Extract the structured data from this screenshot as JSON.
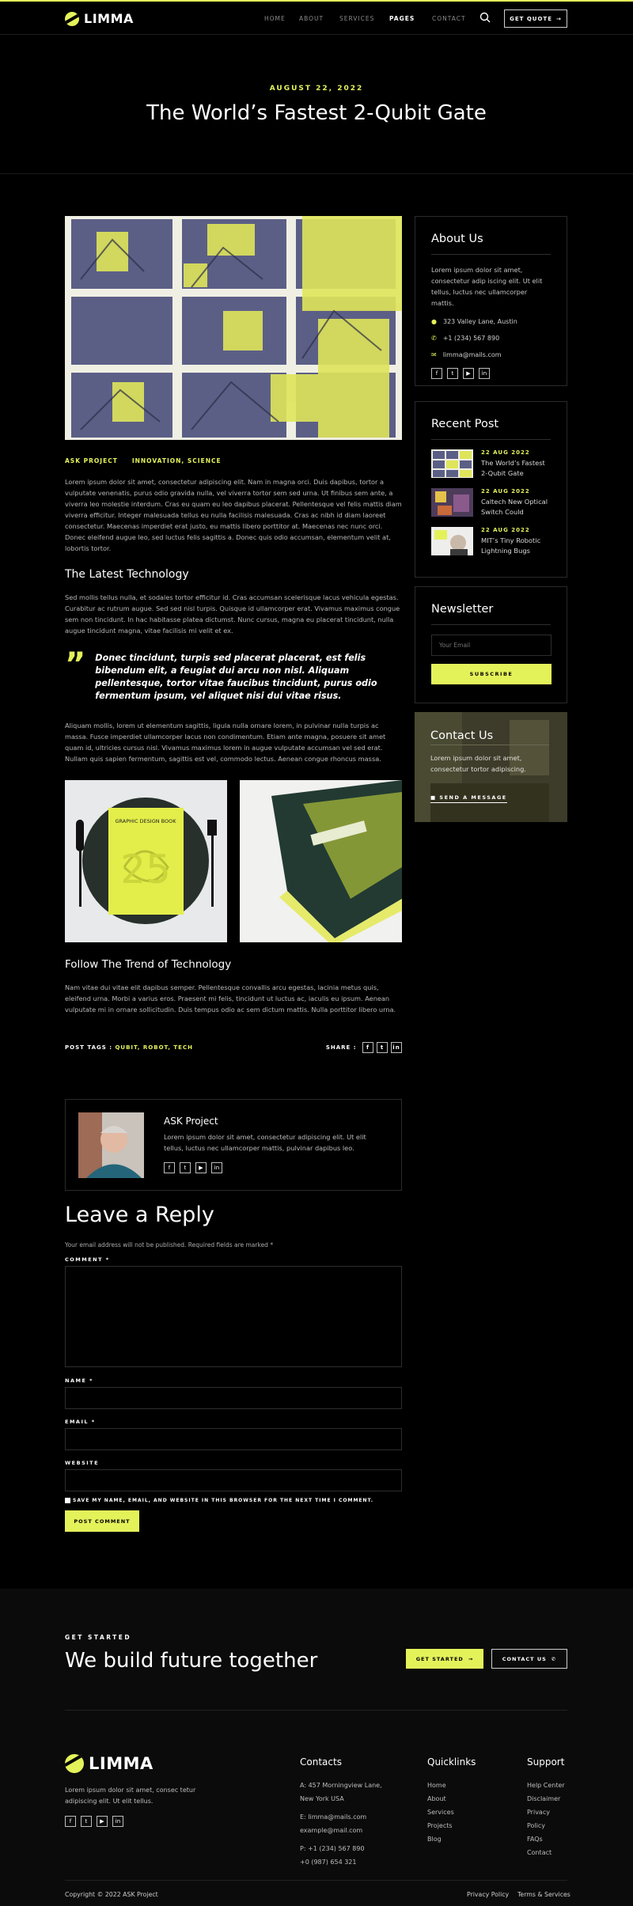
{
  "header": {
    "logo": "LIMMA",
    "nav": [
      "HOME",
      "ABOUT",
      "SERVICES",
      "PAGES",
      "CONTACT"
    ],
    "active_nav": "PAGES",
    "quote_button": "GET QUOTE"
  },
  "hero": {
    "date": "AUGUST 22, 2022",
    "title": "The World’s Fastest 2-Qubit Gate"
  },
  "post": {
    "categories": [
      "ASK PROJECT",
      "INNOVATION, SCIENCE"
    ],
    "intro": "Lorem ipsum dolor sit amet, consectetur adipiscing elit. Nam in magna orci. Duis dapibus, tortor a vulputate venenatis, purus odio gravida nulla, vel viverra tortor sem sed urna. Ut finibus sem ante, a viverra leo molestie interdum. Cras eu quam eu leo dapibus placerat. Pellentesque vel felis mattis diam viverra efficitur. Integer malesuada tellus eu nulla facilisis malesuada. Cras ac nibh id diam laoreet consectetur. Maecenas imperdiet erat justo, eu mattis libero porttitor at. Maecenas nec nunc orci. Donec eleifend augue leo, sed luctus felis sagittis a. Donec quis odio accumsan, elementum velit at, lobortis tortor.",
    "h_latest": "The Latest Technology",
    "para2": "Sed mollis tellus nulla, et sodales tortor efficitur id. Cras accumsan scelerisque lacus vehicula egestas. Curabitur ac rutrum augue. Sed sed nisl turpis. Quisque id ullamcorper erat. Vivamus maximus congue sem non tincidunt. In hac habitasse platea dictumst. Nunc cursus, magna eu placerat tincidunt, nulla augue tincidunt magna, vitae facilisis mi velit et ex.",
    "quote": "Donec tincidunt, turpis sed placerat placerat, est felis bibendum elit, a feugiat dui arcu non nisl. Aliquam pellentesque, tortor vitae faucibus tincidunt, purus odio fermentum ipsum, vel aliquet nisi dui vitae risus.",
    "para3": "Aliquam mollis, lorem ut elementum sagittis, ligula nulla ornare lorem, in pulvinar nulla turpis ac massa. Fusce imperdiet ullamcorper lacus non condimentum. Etiam ante magna, posuere sit amet quam id, ultricies cursus nisl. Vivamus maximus lorem in augue vulputate accumsan vel sed erat. Nullam quis sapien fermentum, sagittis est vel, commodo lectus. Aenean congue rhoncus massa.",
    "book_cover_text": "GRAPHIC DESIGN BOOK",
    "book_cover_number": "25",
    "h_trend": "Follow The Trend of Technology",
    "para4": "Nam vitae dui vitae elit dapibus semper. Pellentesque convallis arcu egestas, lacinia metus quis, eleifend urna. Morbi a varius eros. Praesent mi felis, tincidunt ut luctus ac, iaculis eu ipsum. Aenean vulputate mi in ornare sollicitudin. Duis tempus odio ac sem dictum mattis. Nulla porttitor libero urna.",
    "tags_label": "POST TAGS :",
    "tags": "QUBIT, ROBOT, TECH",
    "share_label": "SHARE :",
    "share_icons": [
      "f",
      "t",
      "in"
    ]
  },
  "author": {
    "name": "ASK Project",
    "bio": "Lorem ipsum dolor sit amet, consectetur adipiscing elit. Ut elit tellus, luctus nec ullamcorper mattis, pulvinar dapibus leo.",
    "icons": [
      "facebook-icon",
      "twitter-icon",
      "youtube-icon",
      "linkedin-icon"
    ]
  },
  "sidebar": {
    "about_title": "About Us",
    "about_text": "Lorem ipsum dolor sit amet, consectetur adip iscing elit. Ut elit tellus, luctus nec ullamcorper mattis.",
    "address": "323 Valley Lane, Austin",
    "phone": "+1 (234) 567 890",
    "email": "limma@mails.com",
    "recent_title": "Recent Post",
    "recent": [
      {
        "date": "22 AUG 2022",
        "title": "The World’s Fastest 2-Qubit Gate"
      },
      {
        "date": "22 AUG 2022",
        "title": "Caltech New Optical Switch Could"
      },
      {
        "date": "22 AUG 2022",
        "title": "MIT’s Tiny Robotic Lightning Bugs"
      }
    ],
    "newsletter_title": "Newsletter",
    "newsletter_placeholder": "Your Email",
    "subscribe": "SUBSCRIBE",
    "contact_title": "Contact Us",
    "contact_text": "Lorem ipsum dolor sit amet, consectetur tortor adipiscing.",
    "contact_link": "SEND A MESSAGE"
  },
  "reply": {
    "title": "Leave a Reply",
    "note": "Your email address will not be published. Required fields are marked *",
    "comment_label": "COMMENT *",
    "name_label": "NAME *",
    "email_label": "EMAIL *",
    "website_label": "WEBSITE",
    "consent": "SAVE MY NAME, EMAIL, AND WEBSITE IN THIS BROWSER FOR THE NEXT TIME I COMMENT.",
    "submit": "POST COMMENT"
  },
  "cta": {
    "eyebrow": "GET STARTED",
    "title": "We build future together",
    "btn1": "GET STARTED",
    "btn2": "CONTACT US"
  },
  "footer": {
    "logo": "LIMMA",
    "text": "Lorem ipsum dolor sit amet, consec tetur adipiscing elit. Ut elit tellus.",
    "contacts_title": "Contacts",
    "address": "A: 457 Morningview Lane, New York USA",
    "email1": "E: limma@mails.com",
    "email2": "example@mail.com",
    "phone1": "P: +1 (234) 567 890",
    "phone2": "+0 (987) 654 321",
    "quick_title": "Quicklinks",
    "quick": [
      "Home",
      "About",
      "Services",
      "Projects",
      "Blog"
    ],
    "support_title": "Support",
    "support": [
      "Help Center",
      "Disclaimer",
      "Privacy Policy",
      "FAQs",
      "Contact"
    ],
    "copyright": "Copyright © 2022 ASK Project",
    "privacy": "Privacy Policy",
    "terms": "Terms & Services"
  },
  "colors": {
    "accent": "#e4f25a",
    "background": "#000000",
    "footer_bg": "#0b0b0b"
  }
}
